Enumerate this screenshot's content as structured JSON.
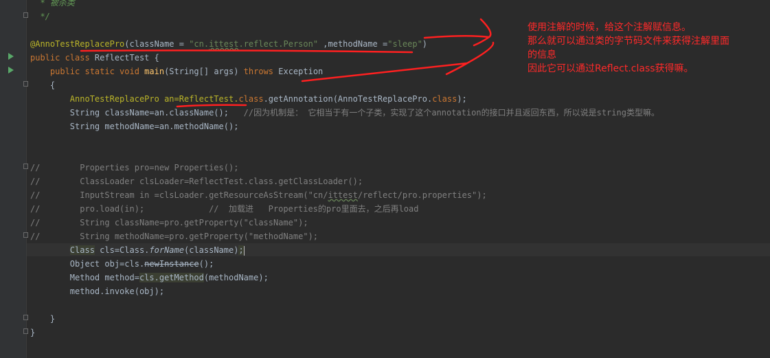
{
  "editor": {
    "lines": {
      "doc1": "  * 被杀类",
      "doc2": "  */",
      "ann_name": "@AnnoTestReplacePro",
      "ann_open": "(className = ",
      "ann_str_q1": "\"cn.",
      "ann_str_ittest": "ittest",
      "ann_str_rest": ".reflect.Person\"",
      "ann_mid": " ,methodName =",
      "ann_str2": "\"sleep\"",
      "ann_close": ")",
      "class_kw": "public class ",
      "class_name": "ReflectTest {",
      "main_kw": "    public static void ",
      "main_fn": "main",
      "main_args": "(String[] args) ",
      "main_throws": "throws",
      "main_exc": " Exception",
      "brace_open": "    {",
      "l1_a": "        AnnoTestReplacePro an=ReflectTest.",
      "l1_class": "class",
      "l1_b": ".getAnnotation(AnnoTestReplacePro.",
      "l1_class2": "class",
      "l1_c": ");",
      "l2_code": "        String className=an.className();   ",
      "l2_comment": "//因为机制是： 它相当于有一个子类，实现了这个annotation的接口并且返回东西，所以说是string类型嘛。",
      "l3": "        String methodName=an.methodName();",
      "c1": "//        Properties pro=new Properties();",
      "c2": "//        ClassLoader clsLoader=ReflectTest.class.getClassLoader();",
      "c3a": "//        InputStream in =clsLoader.getResourceAsStream(\"cn/",
      "c3b": "ittest",
      "c3c": "/reflect/pro.properties\");",
      "c4": "//        pro.load(in);             //  加载进   Properties的pro里面去，之后再load",
      "c5": "//        String className=pro.getProperty(\"className\");",
      "c6": "//        String methodName=pro.getProperty(\"methodName\");",
      "cls_pre": "        ",
      "cls_type": "Class",
      "cls_mid": " cls=Class.",
      "cls_fn": "forName",
      "cls_end": "(className)",
      "cls_semi": ";",
      "obj_pre": "        Object obj=cls.",
      "obj_fn": "newInstance",
      "obj_end": "();",
      "m_pre": "        Method method=",
      "m_hl": "cls.getMethod",
      "m_end": "(methodName);",
      "inv": "        method.invoke(obj);",
      "brace_close_inner": "    }",
      "brace_close_outer": "}"
    }
  },
  "note": {
    "line1": "使用注解的时候，给这个注解赋信息。",
    "line2": "那么就可以通过类的字节码文件来获得注解里面",
    "line3": "的信息",
    "line4": "因此它可以通过Reflect.class获得嘛。"
  },
  "colors": {
    "background": "#2b2b2b",
    "keyword": "#cc7832",
    "annotation": "#bbb529",
    "string": "#6a8759",
    "comment": "#808080",
    "note_red": "#ff2a2a"
  }
}
